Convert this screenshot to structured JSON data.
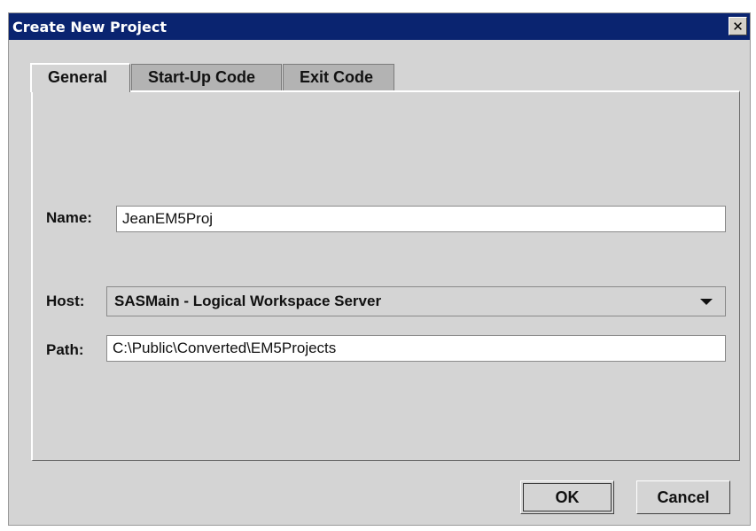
{
  "window": {
    "title": "Create New Project",
    "close_glyph": "✕"
  },
  "tabs": [
    {
      "label": "General",
      "selected": true
    },
    {
      "label": "Start-Up Code",
      "selected": false
    },
    {
      "label": "Exit Code",
      "selected": false
    }
  ],
  "form": {
    "name": {
      "label": "Name:",
      "value": "JeanEM5Proj"
    },
    "host": {
      "label": "Host:",
      "value": "SASMain - Logical Workspace Server"
    },
    "path": {
      "label": "Path:",
      "value": "C:\\Public\\Converted\\EM5Projects"
    }
  },
  "buttons": {
    "ok": "OK",
    "cancel": "Cancel"
  },
  "icons": {
    "close": "close-icon",
    "dropdown": "chevron-down-icon"
  },
  "colors": {
    "titlebar": "#0a2470",
    "dialog_bg": "#d4d4d4"
  }
}
